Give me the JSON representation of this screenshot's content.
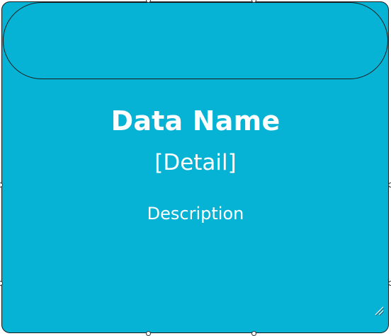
{
  "shape": {
    "fill_color": "#07b3d5",
    "border_color": "#1a1a1a",
    "text_color": "#ffffff",
    "title": "Data Name",
    "detail": "[Detail]",
    "description": "Description"
  },
  "icons": {
    "resize_grip": "resize-grip-icon",
    "selection_handle": "selection-handle"
  }
}
